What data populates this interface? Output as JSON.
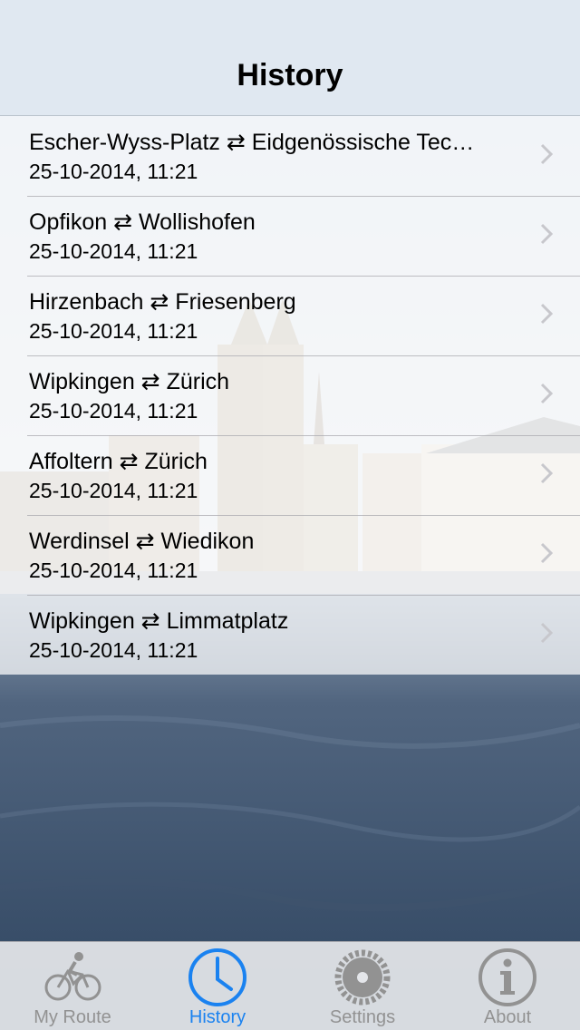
{
  "navbar": {
    "title": "History"
  },
  "history": [
    {
      "route": "Escher-Wyss-Platz ⇄ Eidgenössische Tec…",
      "time": "25-10-2014, 11:21"
    },
    {
      "route": "Opfikon ⇄ Wollishofen",
      "time": "25-10-2014, 11:21"
    },
    {
      "route": "Hirzenbach ⇄ Friesenberg",
      "time": "25-10-2014, 11:21"
    },
    {
      "route": "Wipkingen ⇄ Zürich",
      "time": "25-10-2014, 11:21"
    },
    {
      "route": "Affoltern ⇄ Zürich",
      "time": "25-10-2014, 11:21"
    },
    {
      "route": "Werdinsel ⇄ Wiedikon",
      "time": "25-10-2014, 11:21"
    },
    {
      "route": "Wipkingen ⇄ Limmatplatz",
      "time": "25-10-2014, 11:21"
    }
  ],
  "tabbar": {
    "tabs": [
      {
        "label": "My Route",
        "icon": "bicycle-icon",
        "active": false
      },
      {
        "label": "History",
        "icon": "clock-icon",
        "active": true
      },
      {
        "label": "Settings",
        "icon": "gear-icon",
        "active": false
      },
      {
        "label": "About",
        "icon": "info-icon",
        "active": false
      }
    ]
  },
  "colors": {
    "accent": "#1a82f0",
    "inactive": "#929292"
  }
}
